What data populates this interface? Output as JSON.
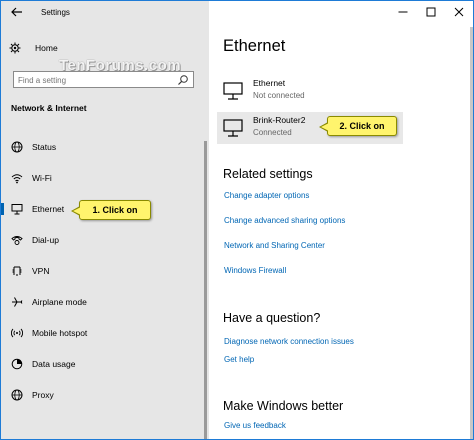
{
  "titlebar": {
    "app_title": "Settings"
  },
  "sidebar": {
    "home_label": "Home",
    "search_placeholder": "Find a setting",
    "section_title": "Network & Internet",
    "items": [
      {
        "label": "Status",
        "icon": "globe-icon"
      },
      {
        "label": "Wi-Fi",
        "icon": "wifi-icon"
      },
      {
        "label": "Ethernet",
        "icon": "ethernet-icon",
        "active": true
      },
      {
        "label": "Dial-up",
        "icon": "dialup-icon"
      },
      {
        "label": "VPN",
        "icon": "vpn-icon"
      },
      {
        "label": "Airplane mode",
        "icon": "airplane-icon"
      },
      {
        "label": "Mobile hotspot",
        "icon": "hotspot-icon"
      },
      {
        "label": "Data usage",
        "icon": "data-usage-icon"
      },
      {
        "label": "Proxy",
        "icon": "globe-icon"
      }
    ]
  },
  "watermark": "TenForums.com",
  "main": {
    "title": "Ethernet",
    "connections": [
      {
        "name": "Ethernet",
        "status": "Not connected"
      },
      {
        "name": "Brink-Router2",
        "status": "Connected"
      }
    ],
    "related_heading": "Related settings",
    "related_links": [
      "Change adapter options",
      "Change advanced sharing options",
      "Network and Sharing Center",
      "Windows Firewall"
    ],
    "question_heading": "Have a question?",
    "question_links": [
      "Diagnose network connection issues",
      "Get help"
    ],
    "better_heading": "Make Windows better",
    "better_links": [
      "Give us feedback"
    ]
  },
  "callouts": {
    "first": "1. Click on",
    "second": "2. Click on"
  },
  "colors": {
    "accent": "#0063b1",
    "link": "#0066b4",
    "callout": "#fff46d",
    "sidebar_bg": "#e6e6e6",
    "window_border": "#1e7bd6"
  }
}
